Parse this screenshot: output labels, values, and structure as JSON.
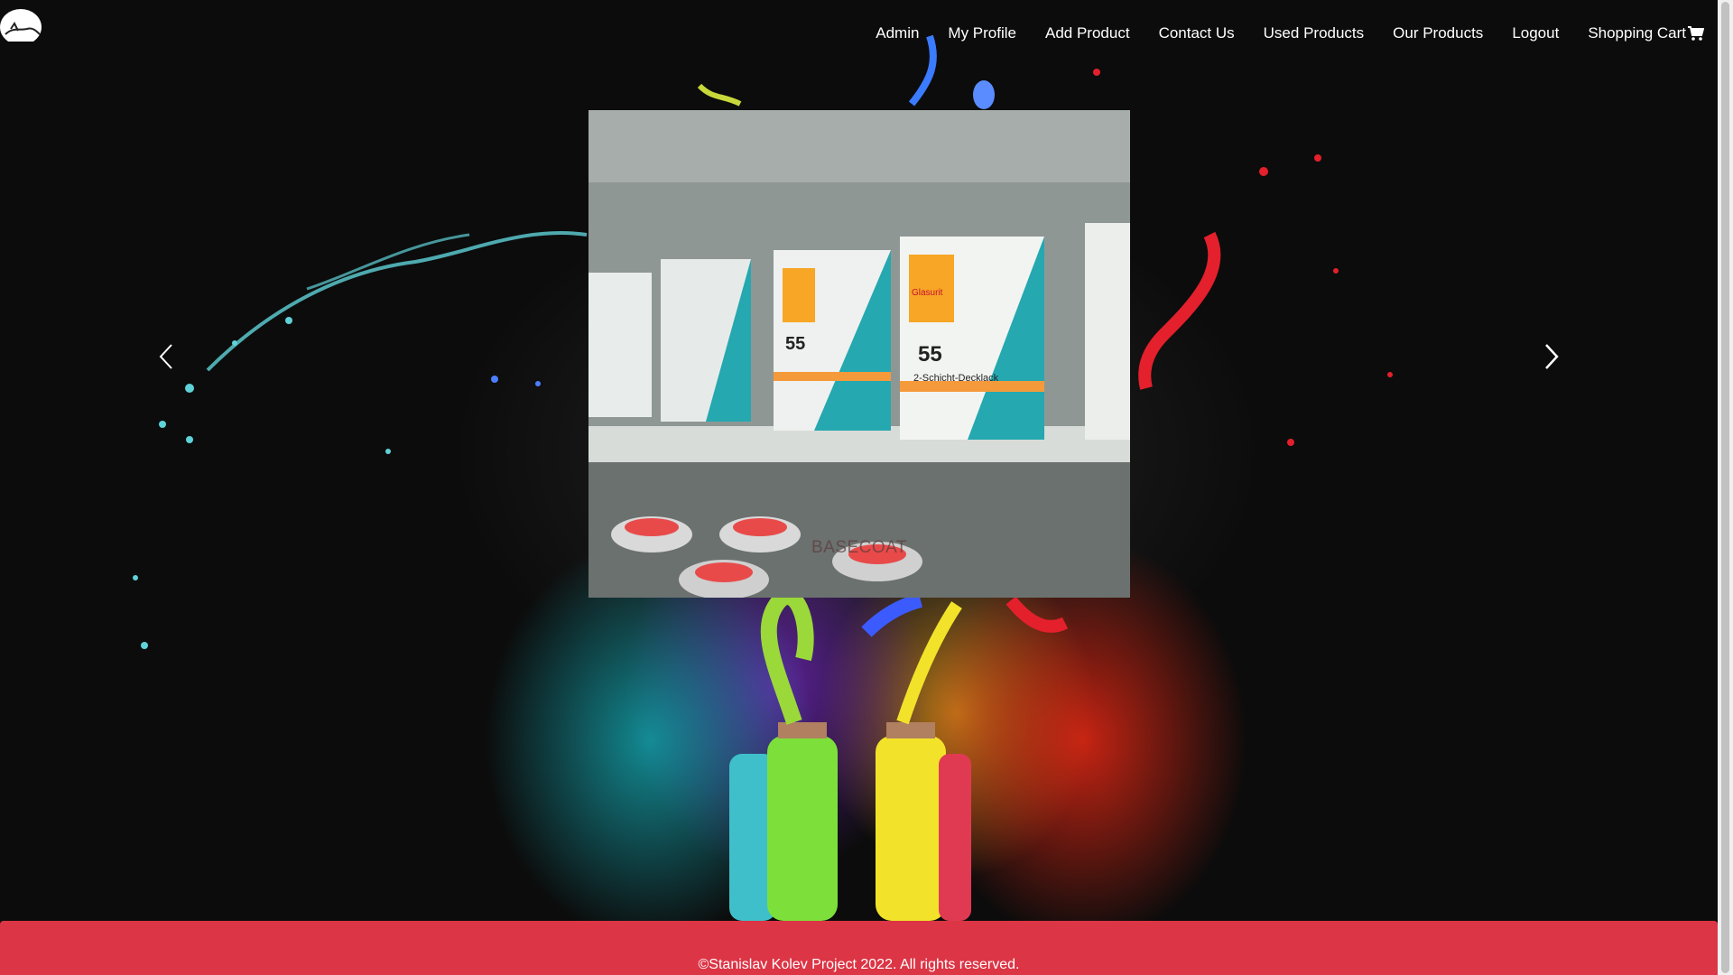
{
  "nav": {
    "items": [
      "Admin",
      "My Profile",
      "Add Product",
      "Contact Us",
      "Used Products",
      "Our Products",
      "Logout"
    ],
    "cart_label": "Shopping Cart"
  },
  "carousel": {
    "caption": "BASECOAT",
    "can_labels": [
      "55",
      "2-Schicht-Decklack",
      "Glasurit"
    ]
  },
  "footer": {
    "text": "©Stanislav Kolev Project 2022. All rights reserved."
  },
  "colors": {
    "footer_bg": "#dc3545",
    "nav_text": "#ffffff",
    "background": "#0c0c0c"
  },
  "icons": [
    "site-logo",
    "shopping-cart-icon",
    "chevron-left-icon",
    "chevron-right-icon"
  ]
}
